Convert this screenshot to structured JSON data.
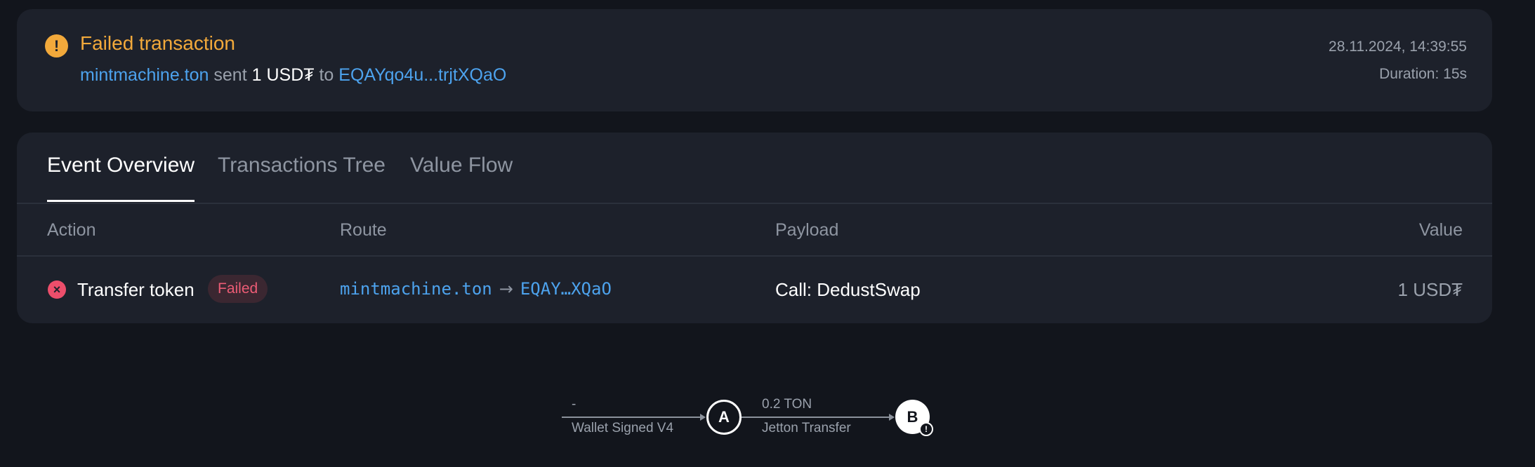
{
  "summary": {
    "title": "Failed transaction",
    "from": "mintmachine.ton",
    "verb": "sent",
    "amount": "1 USD₮",
    "to_word": "to",
    "to": "EQAYqo4u...trjtXQaO",
    "timestamp": "28.11.2024, 14:39:55",
    "duration": "Duration: 15s",
    "colors": {
      "warning": "#f2a93b",
      "link": "#4da3ee"
    },
    "icon": "exclamation-circle-icon"
  },
  "tabs": [
    {
      "label": "Event Overview",
      "active": true
    },
    {
      "label": "Transactions Tree",
      "active": false
    },
    {
      "label": "Value Flow",
      "active": false
    }
  ],
  "table": {
    "headers": {
      "action": "Action",
      "route": "Route",
      "payload": "Payload",
      "value": "Value"
    },
    "rows": [
      {
        "action": "Transfer token",
        "status": "Failed",
        "route_from": "mintmachine.ton",
        "route_arrow": "→",
        "route_to": "EQAY…XQaO",
        "payload": "Call: DedustSwap",
        "value": "1 USD₮",
        "icon": "error-circle-icon"
      }
    ]
  },
  "diagram": {
    "edge1_top": "-",
    "edge1_bottom": "Wallet Signed V4",
    "node_a": "A",
    "edge2_top": "0.2 TON",
    "edge2_bottom": "Jetton Transfer",
    "node_b": "B"
  }
}
